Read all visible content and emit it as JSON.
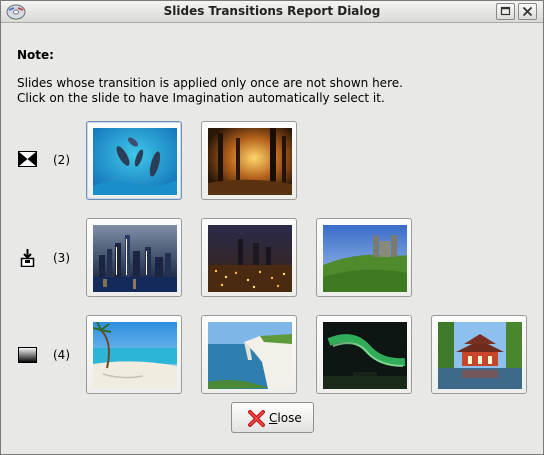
{
  "window": {
    "title": "Slides Transitions Report Dialog",
    "icons": [
      "app-disc-icon",
      "maximize-icon",
      "close-icon"
    ]
  },
  "note": {
    "heading": "Note:",
    "line1": "Slides whose transition is applied only once are not shown here.",
    "line2": "Click on the slide to have Imagination automatically select it."
  },
  "rows": [
    {
      "count_label": "(2)",
      "icon": "cross-fade-transition-icon",
      "slides": [
        "underwater-dolphins-image",
        "sunlit-forest-image"
      ]
    },
    {
      "count_label": "(3)",
      "icon": "slide-in-transition-icon",
      "slides": [
        "city-skyline-night-image",
        "city-lights-night-image",
        "castle-hill-image"
      ]
    },
    {
      "count_label": "(4)",
      "icon": "wipe-gradient-transition-icon",
      "slides": [
        "tropical-beach-image",
        "sea-cliffs-image",
        "aurora-night-sky-image",
        "japanese-temple-image"
      ]
    }
  ],
  "selected_slide": "underwater-dolphins-image",
  "close_button": {
    "mnemonic": "C",
    "rest": "lose",
    "icon": "red-x-icon"
  }
}
